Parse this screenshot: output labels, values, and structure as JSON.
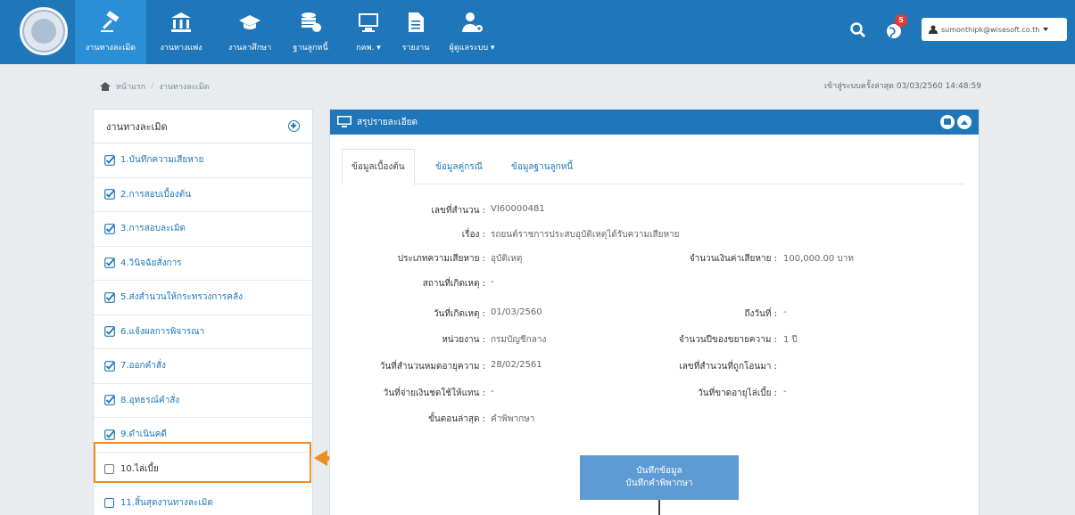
{
  "navbar": {
    "items": [
      {
        "label": "งานทางละเมิด",
        "icon": "gavel-icon"
      },
      {
        "label": "งานทางแพ่ง",
        "icon": "bank-icon"
      },
      {
        "label": "งานลาศึกษา",
        "icon": "graduation-cap-icon"
      },
      {
        "label": "ฐานลูกหนี้",
        "icon": "database-icon"
      },
      {
        "label": "กคพ. ▾",
        "icon": "monitor-icon"
      },
      {
        "label": "รายงาน",
        "icon": "document-icon"
      },
      {
        "label": "ผู้ดูแลระบบ ▾",
        "icon": "user-settings-icon"
      }
    ],
    "notification_count": "5",
    "user_email": "sumonthipk@wisesoft.co.th"
  },
  "breadcrumb": {
    "home": "หน้าแรก",
    "separator": "/",
    "current": "งานทางละเมิด"
  },
  "last_login": "เข้าสู่ระบบครั้งล่าสุด 03/03/2560 14:48:59",
  "sidebar": {
    "title": "งานทางละเมิด",
    "items": [
      {
        "label": "1.บันทึกความเสียหาย",
        "checked": true
      },
      {
        "label": "2.การสอบเบื้องต้น",
        "checked": true
      },
      {
        "label": "3.การสอบละเมิด",
        "checked": true
      },
      {
        "label": "4.วินิจฉัยสั่งการ",
        "checked": true
      },
      {
        "label": "5.ส่งสำนวนให้กระทรวงการคลัง",
        "checked": true
      },
      {
        "label": "6.แจ้งผลการพิจารณา",
        "checked": true
      },
      {
        "label": "7.ออกคำสั่ง",
        "checked": true
      },
      {
        "label": "8.อุทธรณ์คำสั่ง",
        "checked": true
      },
      {
        "label": "9.ดำเนินคดี",
        "checked": true
      },
      {
        "label": "10.ไล่เบี้ย",
        "checked": false
      },
      {
        "label": "11.สิ้นสุดงานทางละเมิด",
        "checked": false
      }
    ]
  },
  "annotation": {
    "step": "4",
    "color": "#f08c22"
  },
  "panel": {
    "title": "สรุปรายละเอียด",
    "tabs": [
      "ข้อมูลเบื้องต้น",
      "ข้อมูลคู่กรณี",
      "ข้อมูลฐานลูกหนี้"
    ],
    "fields": {
      "case_no": {
        "label": "เลขที่สำนวน :",
        "value": "VI60000481"
      },
      "subject": {
        "label": "เรื่อง :",
        "value": "รถยนต์ราชการประสบอุบัติเหตุได้รับความเสียหาย"
      },
      "damage_type": {
        "label": "ประเภทความเสียหาย :",
        "value": "อุบัติเหตุ"
      },
      "damage_amount": {
        "label": "จำนวนเงินค่าเสียหาย :",
        "value": "100,000.00 บาท"
      },
      "place": {
        "label": "สถานที่เกิดเหตุ :",
        "value": "-"
      },
      "incident_date": {
        "label": "วันที่เกิดเหตุ :",
        "value": "01/03/2560"
      },
      "to_date": {
        "label": "ถึงวันที่ :",
        "value": "-"
      },
      "agency": {
        "label": "หน่วยงาน :",
        "value": "กรมบัญชีกลาง"
      },
      "extension_years": {
        "label": "จำนวนปีของขยายความ :",
        "value": "1 ปี"
      },
      "expiry_date": {
        "label": "วันที่สำนวนหมดอายุความ :",
        "value": "28/02/2561"
      },
      "transfer_no": {
        "label": "เลขที่สำนวนที่ถูกโอนมา :",
        "value": ""
      },
      "compensation_date": {
        "label": "วันที่จ่ายเงินชดใช้ให้แทน :",
        "value": "-"
      },
      "recourse_expiry": {
        "label": "วันที่ขาดอายุไล่เบี้ย :",
        "value": "-"
      },
      "latest_step": {
        "label": "ขั้นตอนล่าสุด :",
        "value": "คำพิพากษา"
      }
    },
    "record_button": {
      "line1": "บันทึกข้อมูล",
      "line2": "บันทึกคำพิพากษา"
    }
  },
  "colors": {
    "primary": "#1f77b9",
    "highlight": "#f08c22",
    "badge": "#e5383b"
  }
}
